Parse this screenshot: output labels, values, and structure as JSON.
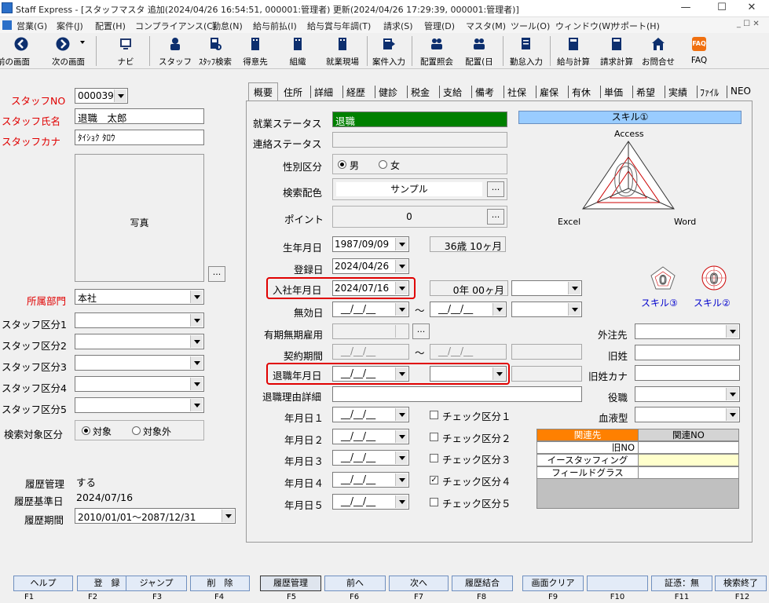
{
  "window": {
    "title": "Staff Express - [スタッフマスタ 追加(2024/04/26 16:54:51, 000001:管理者) 更新(2024/04/26 17:29:39, 000001:管理者)]",
    "minimize": "—",
    "maximize": "☐",
    "close": "✕"
  },
  "menu": [
    "営業(G)",
    "案件(J)",
    "配置(H)",
    "コンプライアンス(C)",
    "勤怠(N)",
    "給与前払(I)",
    "給与賞与年調(T)",
    "請求(S)",
    "管理(D)",
    "マスタ(M)",
    "ツール(O)",
    "ウィンドウ(W)",
    "サポート(H)"
  ],
  "toolbar": {
    "prev": "前の画面",
    "next": "次の画面",
    "items": [
      "ナビ",
      "スタッフ",
      "ｽﾀｯﾌ検索",
      "得意先",
      "組織",
      "就業現場",
      "案件入力",
      "配置照会",
      "配置(日",
      "勤怠入力",
      "給与計算",
      "請求計算",
      "お問合せ",
      "FAQ"
    ]
  },
  "left": {
    "staff_no_label": "スタッフNO",
    "staff_no": "000039",
    "staff_name_label": "スタッフ氏名",
    "staff_name": "退職　太郎",
    "staff_kana_label": "スタッフカナ",
    "staff_kana": "ﾀｲｼｮｸ ﾀﾛｳ",
    "photo_label": "写真",
    "photo_button": "...",
    "dept_label": "所属部門",
    "dept": "本社",
    "cat_labels": [
      "スタッフ区分1",
      "スタッフ区分2",
      "スタッフ区分3",
      "スタッフ区分4",
      "スタッフ区分5"
    ],
    "search_target_label": "検索対象区分",
    "search_target_opt1": "対象",
    "search_target_opt2": "対象外",
    "history_label": "履歴管理",
    "history_value": "する",
    "history_base_label": "履歴基準日",
    "history_base": "2024/07/16",
    "history_period_label": "履歴期間",
    "history_period": "2010/01/01～2087/12/31"
  },
  "tabs": [
    "概要",
    "住所",
    "詳細",
    "経歴",
    "健診",
    "税金",
    "支給",
    "備考",
    "社保",
    "雇保",
    "有休",
    "単価",
    "希望",
    "実績",
    "ﾌｧｲﾙ",
    "NEO"
  ],
  "form": {
    "work_status_label": "就業ステータス",
    "work_status": "退職",
    "contact_status_label": "連絡ステータス",
    "gender_label": "性別区分",
    "gender_male": "男",
    "gender_female": "女",
    "search_color_label": "検索配色",
    "search_color": "サンプル",
    "point_label": "ポイント",
    "point": "0",
    "birth_label": "生年月日",
    "birth": "1987/09/09",
    "age": "36歳 10ヶ月",
    "reg_label": "登録日",
    "reg": "2024/04/26",
    "join_label": "入社年月日",
    "join": "2024/07/16",
    "tenure": "0年 00ヶ月",
    "invalid_label": "無効日",
    "date_blank": "__/__/__",
    "tilde": "～",
    "fixed_term_label": "有期無期雇用",
    "contract_label": "契約期間",
    "retire_label": "退職年月日",
    "retire_reason_label": "退職理由詳細",
    "ymd_labels": [
      "年月日１",
      "年月日２",
      "年月日３",
      "年月日４",
      "年月日５"
    ],
    "check_labels": [
      "チェック区分１",
      "チェック区分２",
      "チェック区分３",
      "チェック区分４",
      "チェック区分５"
    ],
    "check_states": [
      false,
      false,
      false,
      true,
      false
    ],
    "outsource_label": "外注先",
    "old_name_label": "旧姓",
    "old_kana_label": "旧姓カナ",
    "position_label": "役職",
    "blood_label": "血液型",
    "ellipsis": "..."
  },
  "skill": {
    "header": "スキル①",
    "top": "Access",
    "left": "Excel",
    "right": "Word",
    "center": "0",
    "skill3": "スキル③",
    "skill2": "スキル②"
  },
  "related": {
    "col1": "関連先",
    "col2": "関連NO",
    "rows": [
      "旧NO",
      "イースタッフィング",
      "フィールドグラス"
    ]
  },
  "fkeys": [
    {
      "label": "ヘルプ",
      "key": "F1"
    },
    {
      "label": "登　録",
      "key": "F2"
    },
    {
      "label": "ジャンプ",
      "key": "F3"
    },
    {
      "label": "削　除",
      "key": "F4"
    },
    {
      "label": "履歴管理",
      "key": "F5"
    },
    {
      "label": "前へ",
      "key": "F6"
    },
    {
      "label": "次へ",
      "key": "F7"
    },
    {
      "label": "履歴結合",
      "key": "F8"
    },
    {
      "label": "画面クリア",
      "key": "F9"
    },
    {
      "label": "",
      "key": "F10"
    },
    {
      "label": "証憑：無",
      "key": "F11"
    },
    {
      "label": "検索終了",
      "key": "F12"
    }
  ],
  "colors": {
    "work_status_bg": "#008000",
    "skill_header_bg": "#99ccff",
    "related_header_bg": "#ff8000",
    "fkey_bg": "#e3ebf7",
    "required_label": "#e00000"
  }
}
